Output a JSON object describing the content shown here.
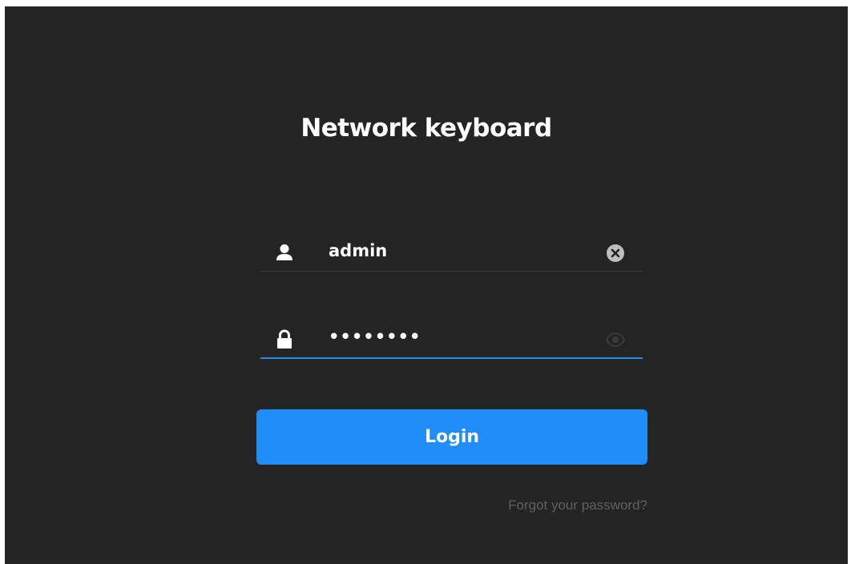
{
  "app": {
    "title": "Network keyboard"
  },
  "form": {
    "username": {
      "value": "admin",
      "icon": "user-icon",
      "clear_icon": "clear-icon"
    },
    "password": {
      "masked_value": "••••••••",
      "icon": "lock-icon",
      "toggle_icon": "eye-icon"
    },
    "login_label": "Login",
    "forgot_label": "Forgot your password?"
  },
  "colors": {
    "background": "#242424",
    "accent": "#1f8ef8",
    "text": "#ffffff",
    "muted": "#5f5f5f"
  }
}
